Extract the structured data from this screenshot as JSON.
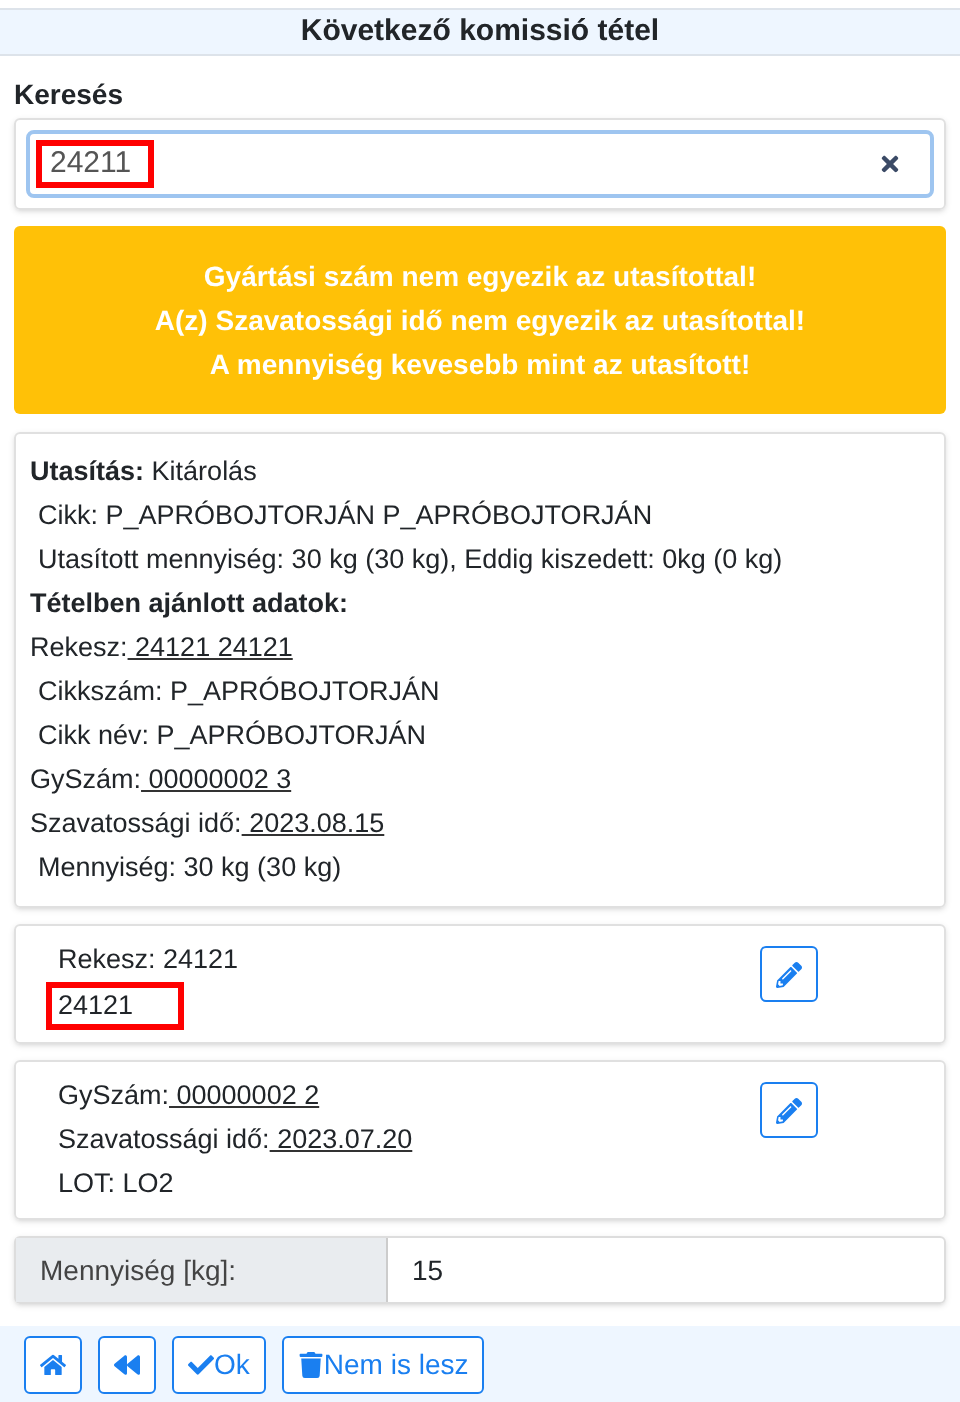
{
  "title": "Következő komissió tétel",
  "search": {
    "label": "Keresés",
    "value": "24211",
    "highlighted": true
  },
  "alerts": [
    "Gyártási szám nem egyezik az utasítottal!",
    "A(z) Szavatossági idő nem egyezik az utasítottal!",
    "A mennyiség kevesebb mint az utasított!"
  ],
  "instruction_rows": [
    {
      "kind": "bold_label",
      "label": "Utasítás:",
      "value": "Kitárolás"
    },
    {
      "kind": "indented",
      "text": "Cikk: P_APRÓBOJTORJÁN P_APRÓBOJTORJÁN"
    },
    {
      "kind": "indented",
      "text": "Utasított mennyiség: 30 kg (30 kg), Eddig kiszedett: 0kg (0 kg)"
    },
    {
      "kind": "heading",
      "text": "Tételben ajánlott adatok:"
    },
    {
      "kind": "underlined",
      "label": "Rekesz:",
      "value": "24121 24121"
    },
    {
      "kind": "indented",
      "text": "Cikkszám: P_APRÓBOJTORJÁN"
    },
    {
      "kind": "indented",
      "text": "Cikk név: P_APRÓBOJTORJÁN"
    },
    {
      "kind": "underlined",
      "label": "GySzám:",
      "value": "00000002 3"
    },
    {
      "kind": "underlined",
      "label": "Szavatossági idő:",
      "value": "2023.08.15"
    },
    {
      "kind": "indented",
      "text": "Mennyiség: 30 kg (30 kg)"
    }
  ],
  "cards": [
    {
      "lines": [
        {
          "kind": "text",
          "text": "Rekesz: 24121",
          "highlighted": false
        },
        {
          "kind": "text",
          "text": "24121",
          "highlighted": true
        }
      ]
    },
    {
      "lines": [
        {
          "kind": "underlined",
          "label": "GySzám:",
          "value": "00000002 2"
        },
        {
          "kind": "underlined",
          "label": "Szavatossági idő:",
          "value": "2023.07.20"
        },
        {
          "kind": "text",
          "text": "LOT: LO2",
          "highlighted": false
        }
      ]
    }
  ],
  "quantity": {
    "label": "Mennyiség [kg]:",
    "value": "15"
  },
  "buttons": [
    {
      "kind": "home"
    },
    {
      "kind": "back"
    },
    {
      "kind": "ok",
      "label": "Ok"
    },
    {
      "kind": "delete",
      "label": "Nem is lesz"
    }
  ]
}
